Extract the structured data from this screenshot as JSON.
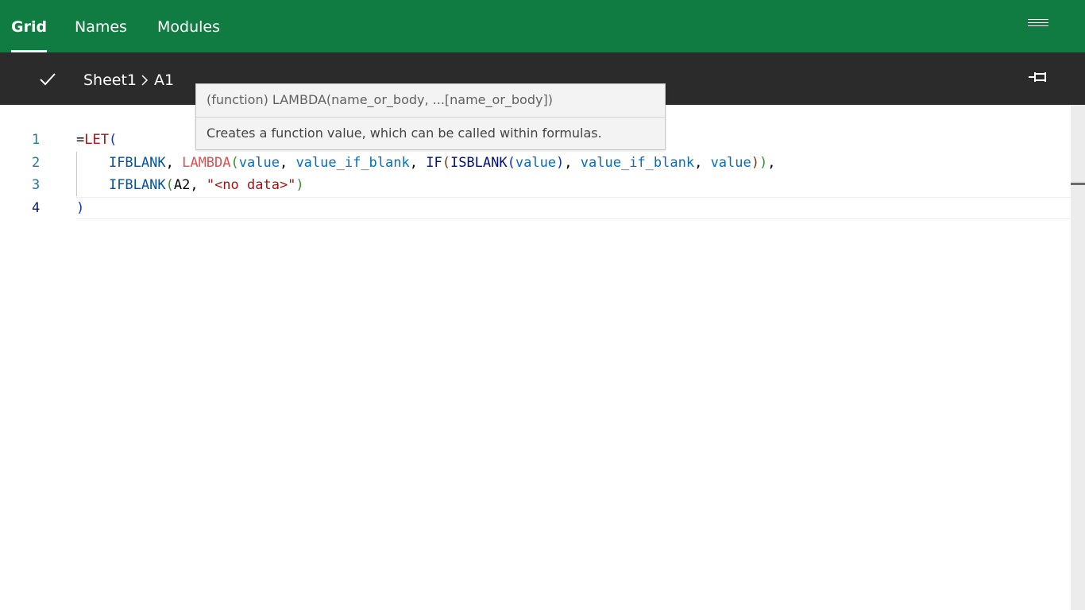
{
  "header": {
    "tabs": [
      {
        "label": "Grid",
        "active": true
      },
      {
        "label": "Names",
        "active": false
      },
      {
        "label": "Modules",
        "active": false
      }
    ],
    "menu_icon": "hamburger-menu-icon"
  },
  "subbar": {
    "confirm_icon": "checkmark-icon",
    "breadcrumb": {
      "sheet": "Sheet1",
      "separator_icon": "chevron-right-icon",
      "cell": "A1"
    },
    "pin_icon": "pin-icon"
  },
  "editor": {
    "line_numbers": [
      "1",
      "2",
      "3",
      "4"
    ],
    "current_line": "4",
    "lines": {
      "l1": {
        "eq": "=",
        "let": "LET",
        "open": "("
      },
      "l2": {
        "indent": "    ",
        "ifblank": "IFBLANK",
        "sep1": ", ",
        "lambda": "LAMBDA",
        "p_open": "(",
        "arg_value": "value",
        "sep2": ", ",
        "arg_vib": "value_if_blank",
        "sep3": ", ",
        "if": "IF",
        "if_open": "(",
        "isblank": "ISBLANK",
        "isb_open": "(",
        "isb_value": "value",
        "isb_close": ")",
        "sep4": ", ",
        "if_vib": "value_if_blank",
        "sep5": ", ",
        "if_value": "value",
        "if_close": ")",
        "lambda_close": ")",
        "trail": ","
      },
      "l3": {
        "indent": "    ",
        "ifblank": "IFBLANK",
        "open": "(",
        "ref": "A2",
        "sep": ", ",
        "str": "\"<no data>\"",
        "close": ")"
      },
      "l4": {
        "close": ")"
      }
    }
  },
  "tooltip": {
    "signature": "(function) LAMBDA(name_or_body, ...[name_or_body])",
    "description": "Creates a function value, which can be called within formulas."
  },
  "colors": {
    "header_bg": "#117c42",
    "subbar_bg": "#2b2b2b",
    "keyword": "#a31515",
    "function": "#0451a5",
    "identifier": "#0070c1",
    "string": "#a31515"
  }
}
